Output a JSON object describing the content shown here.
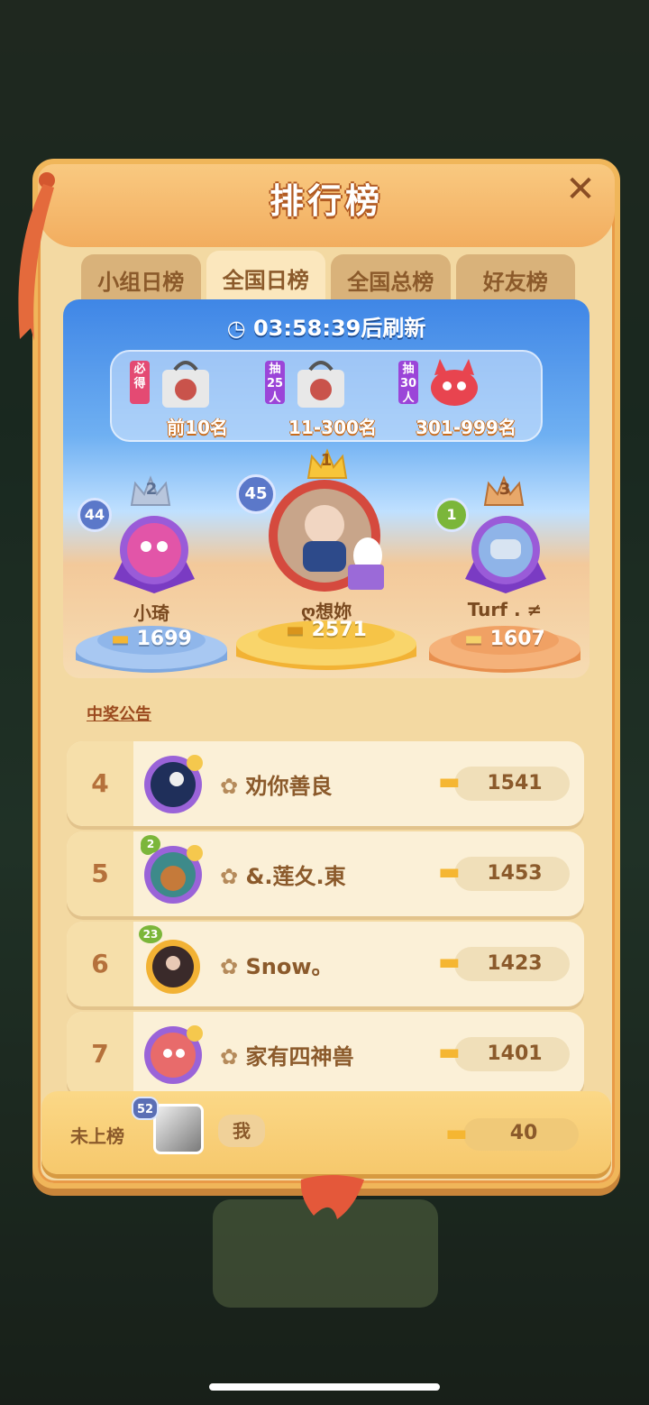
{
  "title": "排行榜",
  "tabs": [
    {
      "label": "小组日榜",
      "active": false
    },
    {
      "label": "全国日榜",
      "active": true
    },
    {
      "label": "全国总榜",
      "active": false
    },
    {
      "label": "好友榜",
      "active": false
    }
  ],
  "timer": "03:58:39后刷新",
  "prizes": [
    {
      "tag": "必得",
      "label": "前10名",
      "icon": "gift-bag-icon"
    },
    {
      "tag": "抽25人",
      "label": "11-300名",
      "icon": "gift-bag-icon"
    },
    {
      "tag": "抽30人",
      "label": "301-999名",
      "icon": "red-creature-plush-icon"
    }
  ],
  "podium": {
    "first": {
      "rank": "1",
      "level": "45",
      "name": "ღ想妳",
      "score": "2571"
    },
    "second": {
      "rank": "2",
      "level": "44",
      "name": "小琦",
      "score": "1699"
    },
    "third": {
      "rank": "3",
      "level": "1",
      "name": "Turf . ≠",
      "score": "1607"
    }
  },
  "announcement": "中奖公告",
  "rows": [
    {
      "rank": "4",
      "name": "劝你善良",
      "score": "1541",
      "level": ""
    },
    {
      "rank": "5",
      "name": "&.莲夂.東",
      "score": "1453",
      "level": "2"
    },
    {
      "rank": "6",
      "name": "Snow。",
      "score": "1423",
      "level": "23"
    },
    {
      "rank": "7",
      "name": "家有四神兽",
      "score": "1401",
      "level": ""
    }
  ],
  "me": {
    "rank_text": "未上榜",
    "level": "52",
    "name": "我",
    "score": "40"
  },
  "colors": {
    "gold": "#f5b632",
    "panel": "#f3d9a2",
    "accent": "#f0b65a"
  }
}
